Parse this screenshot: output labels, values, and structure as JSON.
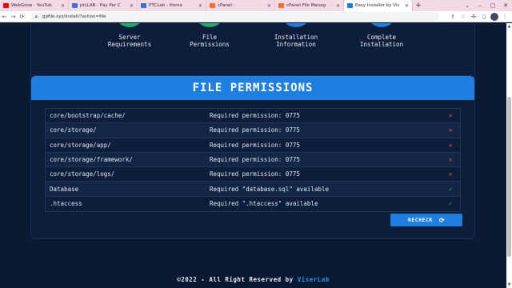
{
  "browser": {
    "tabs": [
      {
        "title": "WebGrow - YouTub",
        "favicon_color": "#ff0000",
        "active": false
      },
      {
        "title": "ptcLAB - Pay Per C",
        "favicon_color": "#3a6fd8",
        "active": false
      },
      {
        "title": "PTCLab - Home",
        "favicon_color": "#3a6fd8",
        "active": false
      },
      {
        "title": "cPanel -",
        "favicon_color": "#ff6c2c",
        "active": false
      },
      {
        "title": "cPanel File Manag",
        "favicon_color": "#ff6c2c",
        "active": false
      },
      {
        "title": "Easy Installer by Vis",
        "favicon_color": "#1e7fe0",
        "active": true
      }
    ],
    "new_tab": "+",
    "address": "gpfile.xyz/install/?action=file",
    "window_controls": {
      "minimize": "–",
      "restore": "▢",
      "close": "✕"
    }
  },
  "steps": [
    {
      "label_line1": "Server",
      "label_line2": "Requirements",
      "color": "#28a86b"
    },
    {
      "label_line1": "File",
      "label_line2": "Permissions",
      "color": "#28a86b"
    },
    {
      "label_line1": "Installation",
      "label_line2": "Information",
      "color": "#1e7fe0"
    },
    {
      "label_line1": "Complete",
      "label_line2": "Installation",
      "color": "#1e7fe0"
    }
  ],
  "panel": {
    "title": "FILE PERMISSIONS",
    "rows": [
      {
        "path": "core/bootstrap/cache/",
        "requirement": "Required permission: 0775",
        "status": "fail",
        "icon": "✕"
      },
      {
        "path": "core/storage/",
        "requirement": "Required permission: 0775",
        "status": "fail",
        "icon": "✕"
      },
      {
        "path": "core/storage/app/",
        "requirement": "Required permission: 0775",
        "status": "fail",
        "icon": "✕"
      },
      {
        "path": "core/storage/framework/",
        "requirement": "Required permission: 0775",
        "status": "fail",
        "icon": "✕"
      },
      {
        "path": "core/storage/logs/",
        "requirement": "Required permission: 0775",
        "status": "fail",
        "icon": "✕"
      },
      {
        "path": "Database",
        "requirement": "Required \"database.sql\" available",
        "status": "ok",
        "icon": "✓"
      },
      {
        "path": ".htaccess",
        "requirement": "Required \".htaccess\" available",
        "status": "ok",
        "icon": "✓"
      }
    ],
    "recheck_label": "RECHECK",
    "recheck_icon": "⟳"
  },
  "footer": {
    "text": "©2022 - All Right Reserved by",
    "brand": "ViserLab"
  },
  "colors": {
    "background": "#0b1a33",
    "accent": "#1e7fe0",
    "success": "#28b463",
    "error": "#e4532b"
  }
}
